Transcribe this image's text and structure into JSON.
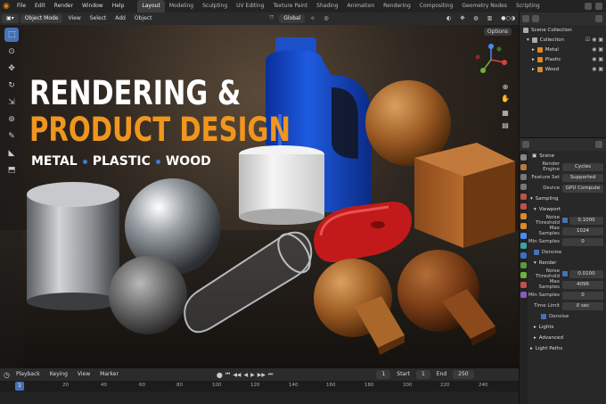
{
  "topbar": {
    "menu": [
      "File",
      "Edit",
      "Render",
      "Window",
      "Help"
    ],
    "workspaces": [
      "Layout",
      "Modeling",
      "Sculpting",
      "UV Editing",
      "Texture Paint",
      "Shading",
      "Animation",
      "Rendering",
      "Compositing",
      "Geometry Nodes",
      "Scripting"
    ],
    "active_workspace": "Layout"
  },
  "viewport_header": {
    "mode": "Object Mode",
    "menus": [
      "View",
      "Select",
      "Add",
      "Object"
    ],
    "orientation": "Global",
    "options": "Options"
  },
  "scene_text": {
    "title_line1": "RENDERING &",
    "title_line2": "PRODUCT DESIGN",
    "materials": [
      "METAL",
      "PLASTIC",
      "WOOD"
    ]
  },
  "outliner": {
    "root": "Scene Collection",
    "collection": "Collection",
    "children": [
      "Metal",
      "Plastic",
      "Wood"
    ]
  },
  "properties": {
    "header": "Scene",
    "render_engine_label": "Render Engine",
    "render_engine": "Cycles",
    "feature_set_label": "Feature Set",
    "feature_set": "Supported",
    "device_label": "Device",
    "device": "GPU Compute",
    "sampling": "Sampling",
    "viewport": "Viewport",
    "noise_threshold_label": "Noise Threshold",
    "viewport_noise_threshold": "0.1000",
    "max_samples_label": "Max Samples",
    "viewport_max_samples": "1024",
    "min_samples_label": "Min Samples",
    "viewport_min_samples": "0",
    "denoise": "Denoise",
    "render": "Render",
    "render_noise_threshold": "0.0100",
    "render_max_samples": "4096",
    "render_min_samples": "0",
    "time_limit_label": "Time Limit",
    "time_limit": "0 sec",
    "lights": "Lights",
    "advanced": "Advanced",
    "light_paths": "Light Paths"
  },
  "timeline": {
    "menus": [
      "Playback",
      "Keying",
      "View",
      "Marker"
    ],
    "current_frame": "1",
    "start_label": "Start",
    "start": "1",
    "end_label": "End",
    "end": "250",
    "ruler": [
      "1",
      "20",
      "40",
      "60",
      "80",
      "100",
      "120",
      "140",
      "160",
      "180",
      "200",
      "220",
      "240"
    ]
  },
  "colors": {
    "accent": "#4772b3",
    "blender_orange": "#e87d0d",
    "title_orange": "#f0961e"
  }
}
